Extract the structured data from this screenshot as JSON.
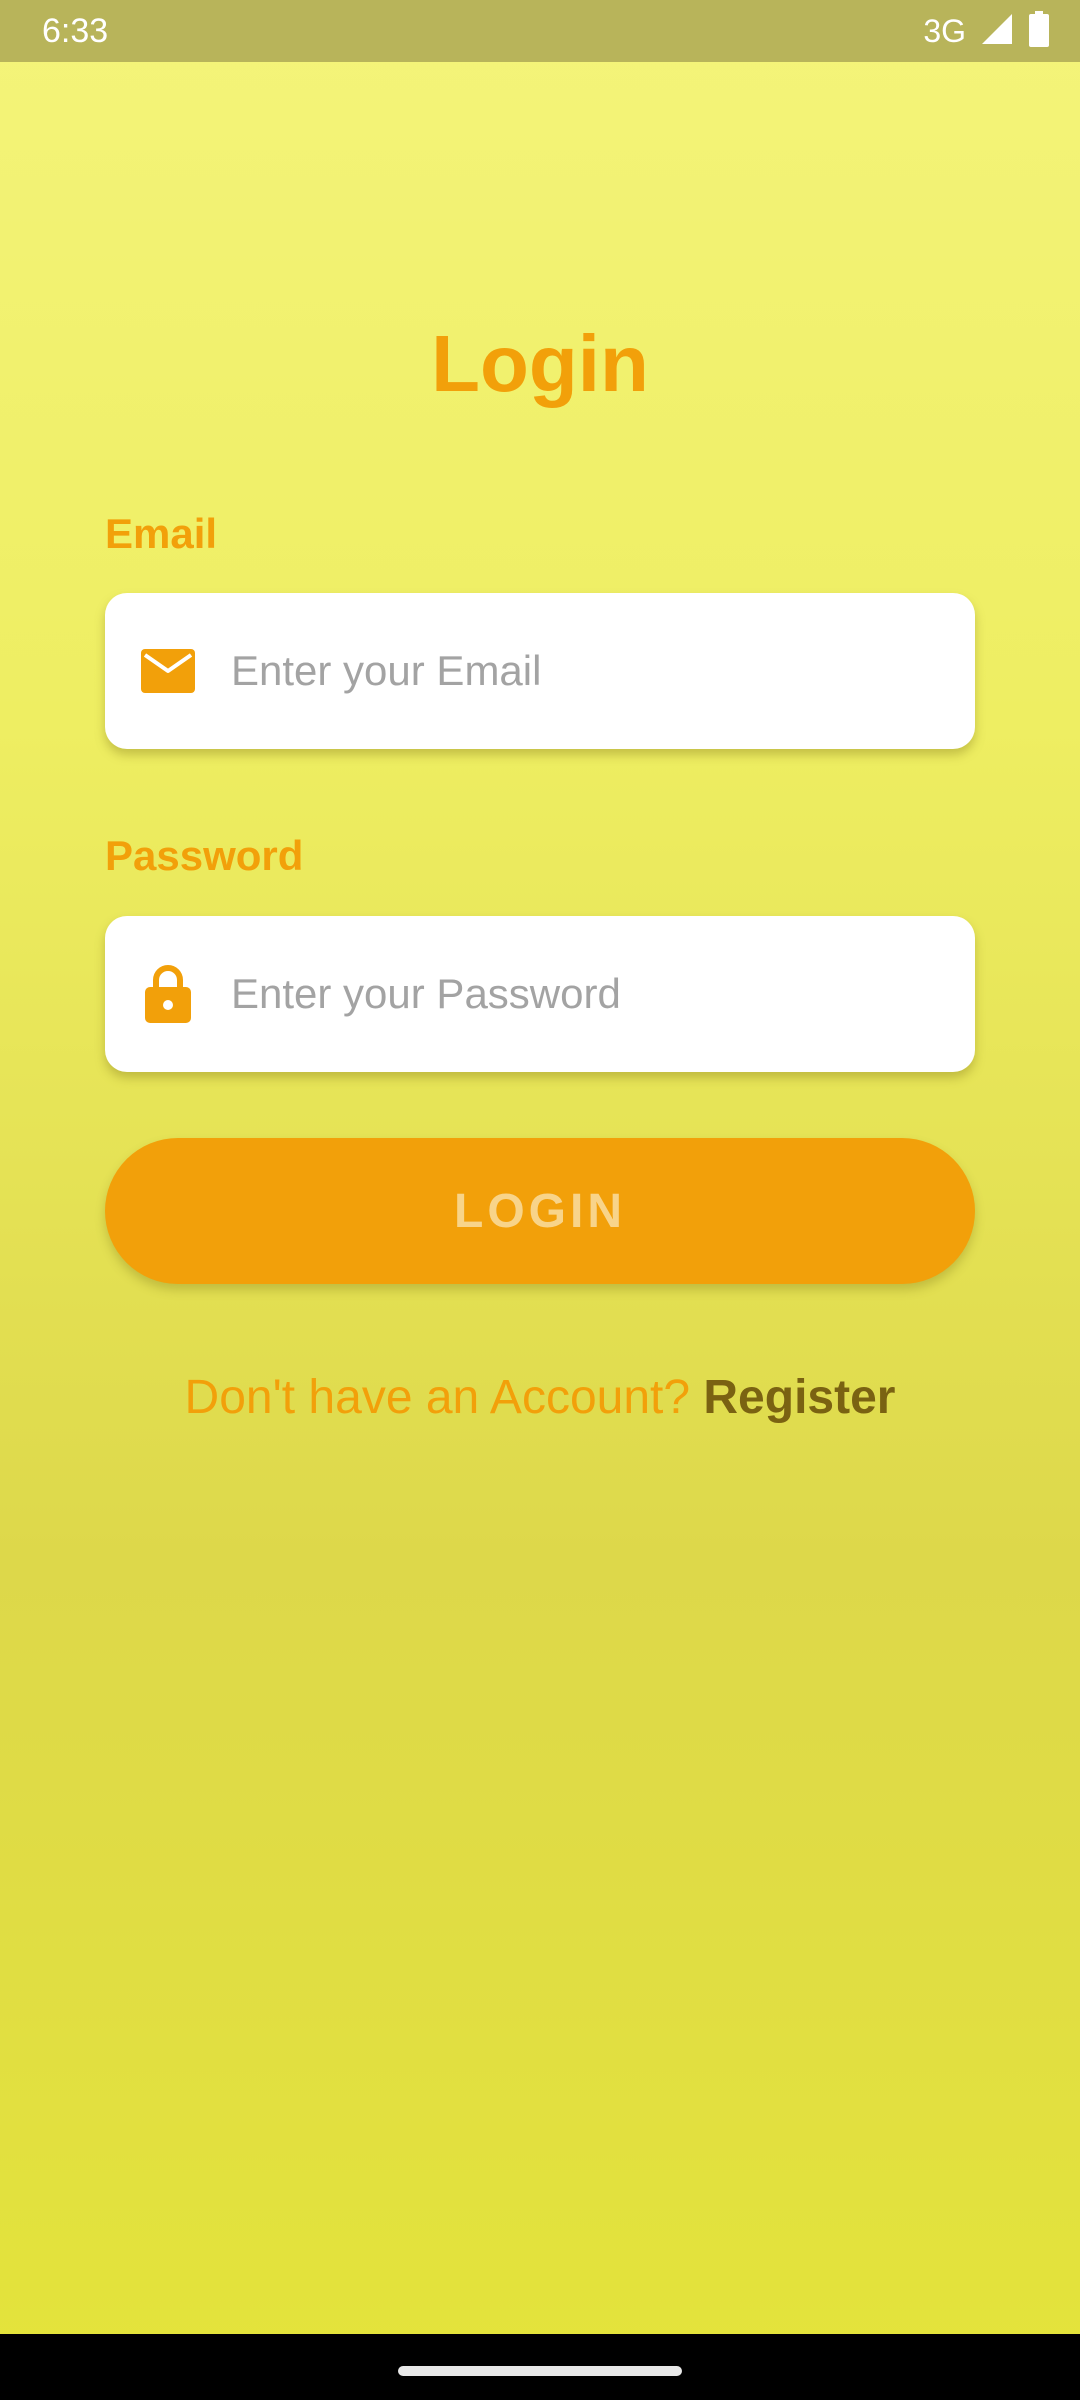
{
  "status_bar": {
    "time": "6:33",
    "network": "3G"
  },
  "login": {
    "title": "Login",
    "email": {
      "label": "Email",
      "placeholder": "Enter your Email",
      "icon": "mail-icon"
    },
    "password": {
      "label": "Password",
      "placeholder": "Enter your Password",
      "icon": "lock-icon"
    },
    "button_label": "LOGIN",
    "register_prompt": "Don't have an Account?",
    "register_link": "Register"
  },
  "colors": {
    "accent": "#f2a00a",
    "link": "#7a6212",
    "status_bar": "#b8b45a",
    "background_top": "#f4f47a",
    "background_bottom": "#e4e43a"
  }
}
